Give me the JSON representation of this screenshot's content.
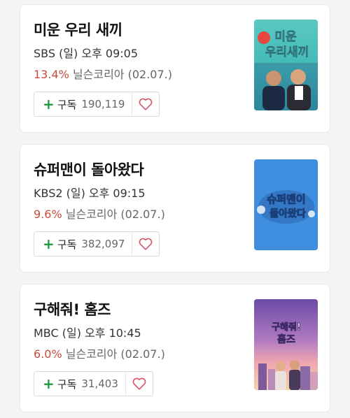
{
  "shows": [
    {
      "title": "미운 우리 새끼",
      "schedule": "SBS (일) 오후 09:05",
      "rating": "13.4%",
      "rating_source": "닐슨코리아 (02.07.)",
      "subscribe_label": "구독",
      "subscribers": "190,119",
      "poster_text": "미운 우리새끼"
    },
    {
      "title": "슈퍼맨이 돌아왔다",
      "schedule": "KBS2 (일) 오후 09:15",
      "rating": "9.6%",
      "rating_source": "닐슨코리아 (02.07.)",
      "subscribe_label": "구독",
      "subscribers": "382,097",
      "poster_text": "슈퍼맨이 돌아왔다"
    },
    {
      "title": "구해줘! 홈즈",
      "schedule": "MBC (일) 오후 10:45",
      "rating": "6.0%",
      "rating_source": "닐슨코리아 (02.07.)",
      "subscribe_label": "구독",
      "subscribers": "31,403",
      "poster_text": "구해줘! 홈즈"
    }
  ],
  "colors": {
    "rating": "#c94a3d",
    "plus": "#1d9b3a",
    "heart": "#d9546a"
  }
}
